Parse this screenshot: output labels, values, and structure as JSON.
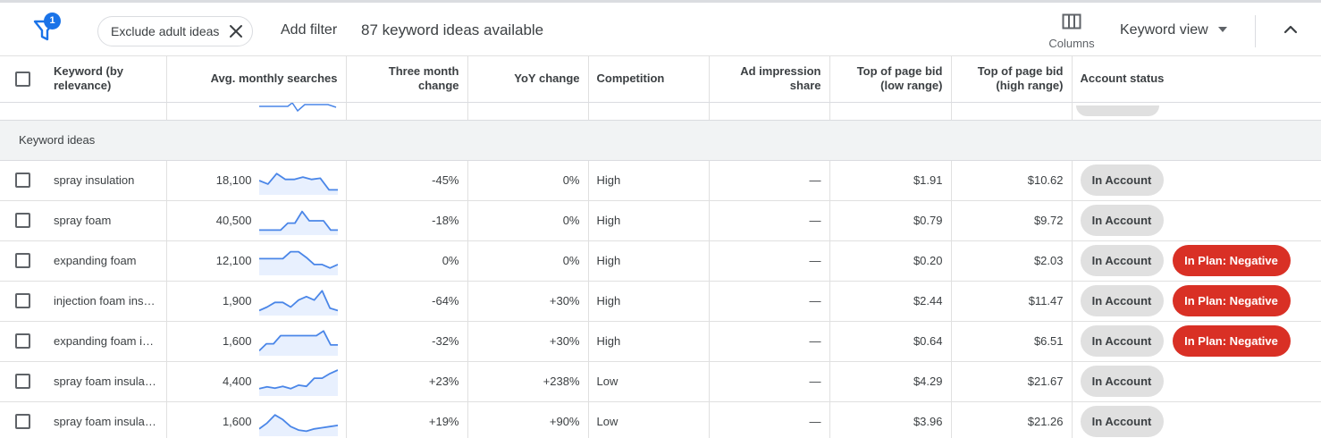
{
  "toolbar": {
    "filter_badge": "1",
    "chip_label": "Exclude adult ideas",
    "add_filter": "Add filter",
    "available": "87 keyword ideas available",
    "columns_label": "Columns",
    "keyword_view": "Keyword view"
  },
  "table": {
    "headers": {
      "keyword": "Keyword (by relevance)",
      "searches": "Avg. monthly searches",
      "three_month": "Three month change",
      "yoy": "YoY change",
      "competition": "Competition",
      "impression": "Ad impression share",
      "bid_low": "Top of page bid (low range)",
      "bid_high": "Top of page bid (high range)",
      "status": "Account status"
    },
    "section_label": "Keyword ideas",
    "rows": [
      {
        "keyword": "spray insulation",
        "searches": "18,100",
        "trend": [
          50,
          35,
          80,
          55,
          55,
          65,
          55,
          60,
          10,
          10
        ],
        "three_month": "-45%",
        "yoy": "0%",
        "competition": "High",
        "impression": "—",
        "bid_low": "$1.91",
        "bid_high": "$10.62",
        "status": [
          "In Account"
        ]
      },
      {
        "keyword": "spray foam",
        "searches": "40,500",
        "trend": [
          10,
          10,
          10,
          10,
          40,
          40,
          90,
          50,
          50,
          50,
          10,
          10
        ],
        "three_month": "-18%",
        "yoy": "0%",
        "competition": "High",
        "impression": "—",
        "bid_low": "$0.79",
        "bid_high": "$9.72",
        "status": [
          "In Account"
        ]
      },
      {
        "keyword": "expanding foam",
        "searches": "12,100",
        "trend": [
          60,
          60,
          60,
          60,
          90,
          90,
          65,
          35,
          35,
          20,
          35
        ],
        "three_month": "0%",
        "yoy": "0%",
        "competition": "High",
        "impression": "—",
        "bid_low": "$0.20",
        "bid_high": "$2.03",
        "status": [
          "In Account",
          "In Plan: Negative"
        ]
      },
      {
        "keyword": "injection foam ins…",
        "searches": "1,900",
        "trend": [
          10,
          25,
          45,
          45,
          25,
          55,
          70,
          55,
          95,
          20,
          10
        ],
        "three_month": "-64%",
        "yoy": "+30%",
        "competition": "High",
        "impression": "—",
        "bid_low": "$2.44",
        "bid_high": "$11.47",
        "status": [
          "In Account",
          "In Plan: Negative"
        ]
      },
      {
        "keyword": "expanding foam i…",
        "searches": "1,600",
        "trend": [
          10,
          40,
          40,
          75,
          75,
          75,
          75,
          75,
          75,
          95,
          35,
          35
        ],
        "three_month": "-32%",
        "yoy": "+30%",
        "competition": "High",
        "impression": "—",
        "bid_low": "$0.64",
        "bid_high": "$6.51",
        "status": [
          "In Account",
          "In Plan: Negative"
        ]
      },
      {
        "keyword": "spray foam insula…",
        "searches": "4,400",
        "trend": [
          20,
          28,
          22,
          30,
          20,
          35,
          30,
          65,
          65,
          85,
          100
        ],
        "three_month": "+23%",
        "yoy": "+238%",
        "competition": "Low",
        "impression": "—",
        "bid_low": "$4.29",
        "bid_high": "$21.67",
        "status": [
          "In Account"
        ]
      },
      {
        "keyword": "spray foam insula…",
        "searches": "1,600",
        "trend": [
          20,
          45,
          80,
          60,
          30,
          15,
          10,
          20,
          25,
          30,
          35
        ],
        "three_month": "+19%",
        "yoy": "+90%",
        "competition": "Low",
        "impression": "—",
        "bid_low": "$3.96",
        "bid_high": "$21.26",
        "status": [
          "In Account"
        ]
      }
    ]
  },
  "colors": {
    "accent_blue": "#1a73e8",
    "trend_line": "#4a86e8",
    "trend_fill": "#e8f0fe",
    "negative_red": "#d93025",
    "pill_gray": "#e0e0e0"
  },
  "icons": [
    "filter-icon",
    "close-icon",
    "columns-icon",
    "caret-down-icon",
    "chevron-up-icon",
    "checkbox"
  ]
}
